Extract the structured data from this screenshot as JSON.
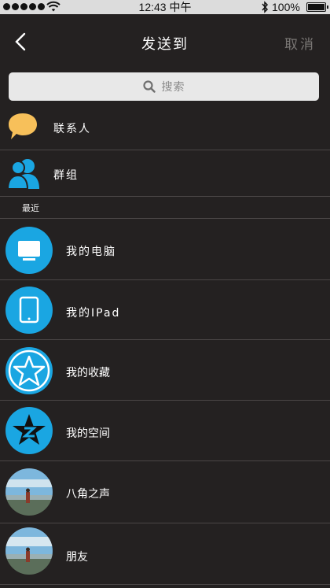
{
  "status_bar": {
    "time": "12:43 中午",
    "battery": "100%"
  },
  "nav": {
    "title": "发送到",
    "cancel": "取消"
  },
  "search": {
    "placeholder": "搜索"
  },
  "top_items": [
    {
      "label": "联系人",
      "icon": "chat-bubble-icon"
    },
    {
      "label": "群组",
      "icon": "group-people-icon"
    }
  ],
  "section_title": "最近",
  "recent": [
    {
      "label": "我的电脑",
      "icon": "computer-icon"
    },
    {
      "label": "我的IPad",
      "icon": "tablet-icon"
    },
    {
      "label": "我的收藏",
      "icon": "star-icon"
    },
    {
      "label": "我的空间",
      "icon": "qzone-icon"
    },
    {
      "label": "八角之声",
      "icon": "photo-avatar"
    },
    {
      "label": "朋友",
      "icon": "photo-avatar"
    }
  ],
  "colors": {
    "background": "#242121",
    "accent": "#1aa6e2",
    "bubble": "#f7c05a",
    "separator": "#4a4646"
  }
}
